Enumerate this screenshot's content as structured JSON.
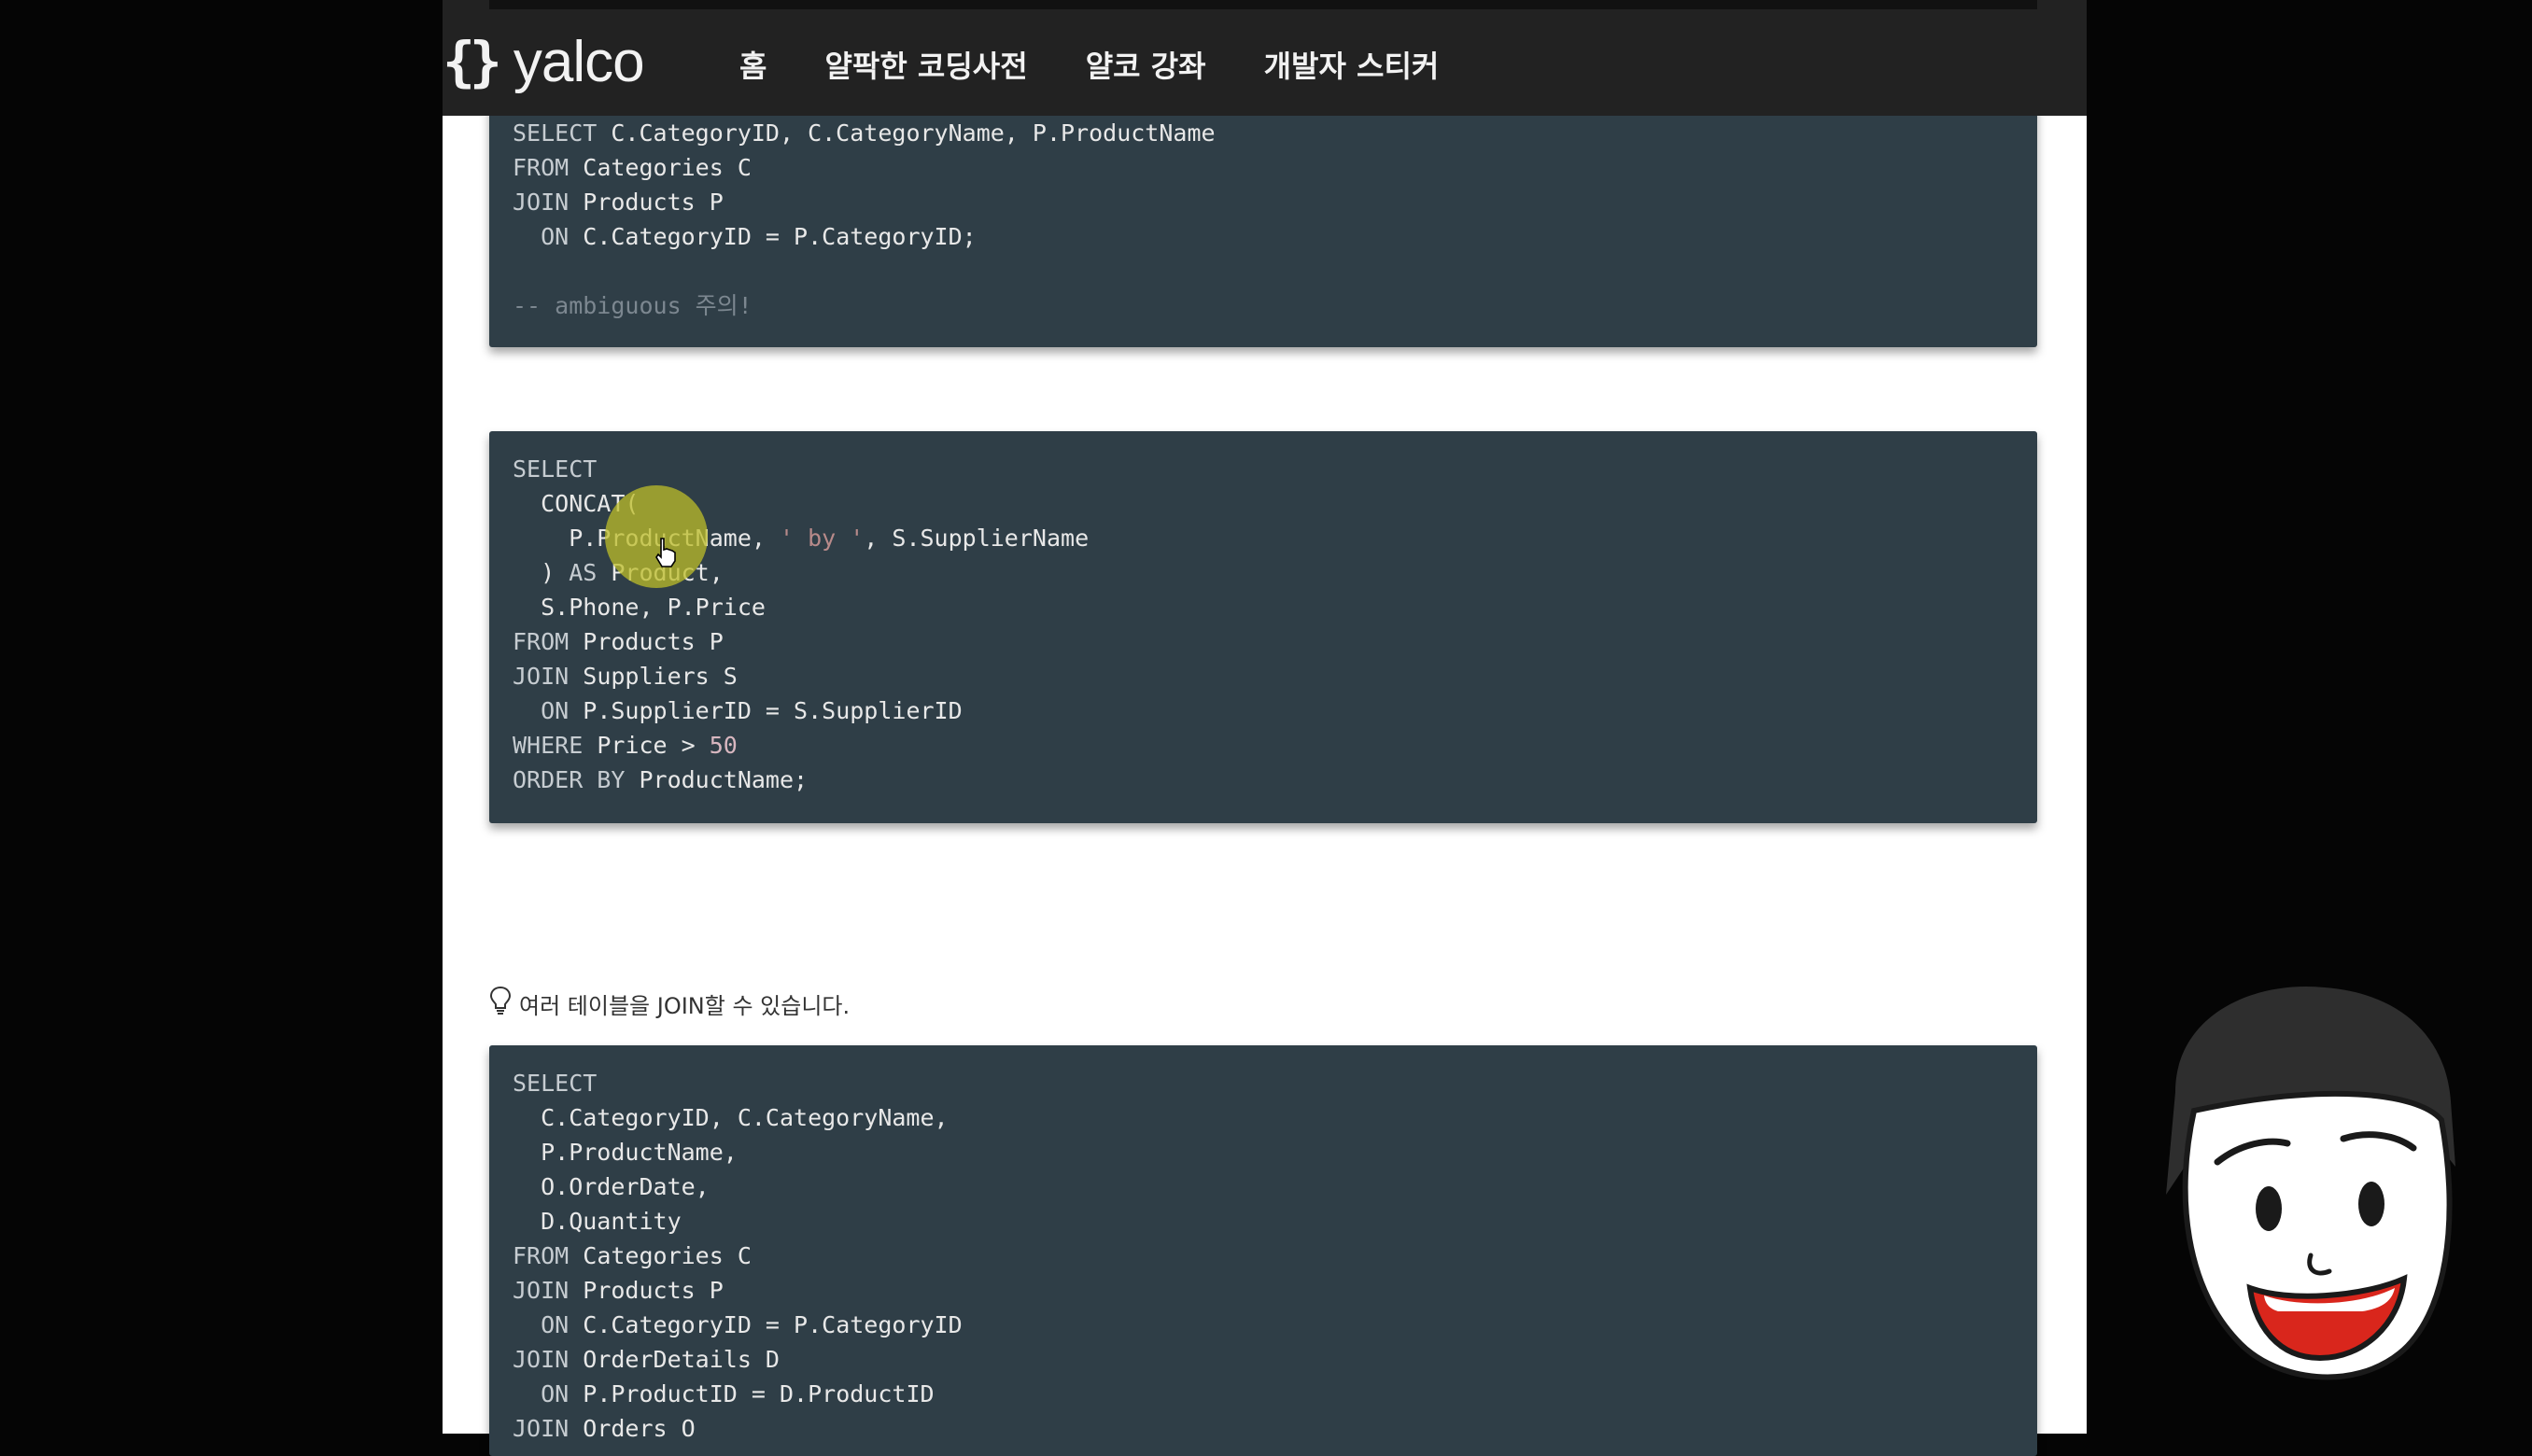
{
  "brand": {
    "logo_braces": "{}",
    "logo_text": "yalco"
  },
  "nav": {
    "items": [
      "홈",
      "얄팍한 코딩사전",
      "얄코 강좌",
      "개발자 스티커"
    ]
  },
  "tip": {
    "icon": "lightbulb-icon",
    "text": "여러 테이블을 JOIN할 수 있습니다."
  },
  "code_blocks": [
    {
      "lines": [
        "SELECT C.CategoryID, C.CategoryName, P.ProductName",
        "FROM Categories C",
        "JOIN Products P",
        "  ON C.CategoryID = P.CategoryID;",
        "",
        "-- ambiguous 주의!"
      ]
    },
    {
      "lines": [
        "SELECT",
        "  CONCAT(",
        "    P.ProductName, ' by ', S.SupplierName",
        "  ) AS Product,",
        "  S.Phone, P.Price",
        "FROM Products P",
        "JOIN Suppliers S",
        "  ON P.SupplierID = S.SupplierID",
        "WHERE Price > 50",
        "ORDER BY ProductName;"
      ]
    },
    {
      "lines": [
        "SELECT",
        "  C.CategoryID, C.CategoryName,",
        "  P.ProductName,",
        "  O.OrderDate,",
        "  D.Quantity",
        "FROM Categories C",
        "JOIN Products P",
        "  ON C.CategoryID = P.CategoryID",
        "JOIN OrderDetails D",
        "  ON P.ProductID = D.ProductID",
        "JOIN Orders O"
      ]
    }
  ],
  "colors": {
    "navbar_bg": "#222222",
    "code_bg": "#2f3e47",
    "cursor_highlight": "#bebe28"
  }
}
